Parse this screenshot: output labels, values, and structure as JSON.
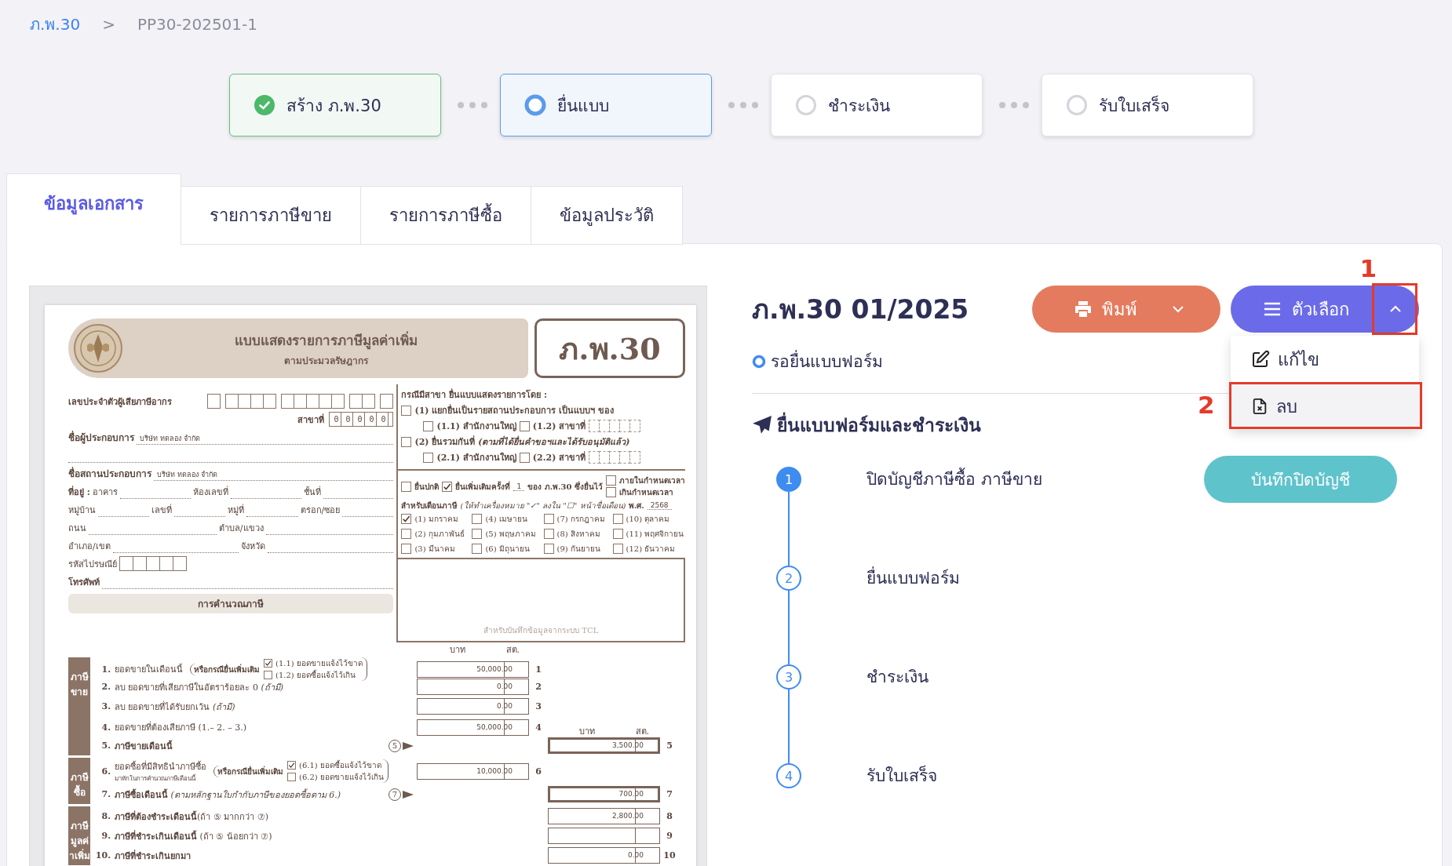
{
  "breadcrumb": {
    "items": [
      {
        "label": "ภ.พ.30",
        "kind": "link"
      },
      {
        "label": "PP30-202501-1",
        "kind": "current"
      }
    ],
    "separator": ">"
  },
  "progress_steps": [
    {
      "label": "สร้าง ภ.พ.30",
      "done": true,
      "selected": false
    },
    {
      "label": "ยื่นแบบ",
      "done": false,
      "selected": true
    },
    {
      "label": "ชำระเงิน",
      "done": false,
      "selected": false
    },
    {
      "label": "รับใบเสร็จ",
      "done": false,
      "selected": false
    }
  ],
  "tabs": [
    {
      "label": "ข้อมูลเอกสาร",
      "selected": true
    },
    {
      "label": "รายการภาษีขาย",
      "selected": false
    },
    {
      "label": "รายการภาษีซื้อ",
      "selected": false
    },
    {
      "label": "ข้อมูลประวัติ",
      "selected": false
    }
  ],
  "form": {
    "title": "แบบแสดงรายการภาษีมูลค่าเพิ่ม",
    "subtitle": "ตามประมวลรัษฎากร",
    "code": "ภ.พ.30",
    "taxpayer_id_label": "เลขประจำตัวผู้เสียภาษีอากร",
    "branch_label": "สาขาที่",
    "branch_number": "00000",
    "operator": {
      "label": "ชื่อผู้ประกอบการ",
      "value": "บริษัท ทดลอง จำกัด"
    },
    "establishment": {
      "label": "ชื่อสถานประกอบการ",
      "value": "บริษัท ทดลอง จำกัด"
    },
    "address_lines": [
      [
        "**ที่อยู่ :** อาคาร",
        "ห้องเลขที่",
        "ชั้นที่"
      ],
      [
        "หมู่บ้าน",
        "เลขที่",
        "หมู่ที่",
        "ตรอก/ซอย"
      ],
      [
        "ถนน",
        "ตำบล/แขวง"
      ],
      [
        "อำเภอ/เขต",
        "จังหวัด"
      ]
    ],
    "postcode_label": "รหัสไปรษณีย์",
    "phone_label": "โทรศัพท์",
    "calc_title": "การคำนวณภาษี",
    "branch_filing": {
      "title": "กรณีมีสาขา ยื่นแบบแสดงรายการโดย :",
      "options": [
        {
          "label": "(1) แยกยื่นเป็นรายสถานประกอบการ  เป็นแบบฯ ของ",
          "checked": false,
          "sub": [
            {
              "label": "(1.1) สำนักงานใหญ่",
              "checked": false,
              "kind": "plain"
            },
            {
              "label": "(1.2) สาขาที่",
              "checked": false,
              "kind": "branch"
            }
          ]
        },
        {
          "label": "(2) ยื่นรวมกันที่ *(ตามที่ได้ยื่นคำขอฯและได้รับอนุมัติแล้ว)*",
          "checked": false,
          "sub": [
            {
              "label": "(2.1) สำนักงานใหญ่",
              "checked": false,
              "kind": "plain"
            },
            {
              "label": "(2.2) สาขาที่",
              "checked": false,
              "kind": "branch"
            }
          ]
        }
      ]
    },
    "filing": {
      "normal": {
        "label": "ยื่นปกติ",
        "checked": false
      },
      "additional": {
        "label": "ยื่นเพิ่มเติมครั้งที่",
        "checked": true,
        "count": "1",
        "suffix": "ของ ภ.พ.30 ซึ่งยื่นไว้"
      },
      "timing": [
        {
          "label": "ภายในกำหนดเวลา",
          "checked": false
        },
        {
          "label": "เกินกำหนดเวลา",
          "checked": false
        }
      ]
    },
    "tax_month": {
      "label": "**สำหรับเดือนภาษี** *(ให้ทำเครื่องหมาย \"✓\" ลงใน \"☐\" หน้าชื่อเดือน)* **พ.ศ.**",
      "year": "2568",
      "months": [
        {
          "label": "(1) มกราคม",
          "checked": true
        },
        {
          "label": "(2) กุมภาพันธ์",
          "checked": false
        },
        {
          "label": "(3) มีนาคม",
          "checked": false
        },
        {
          "label": "(4) เมษายน",
          "checked": false
        },
        {
          "label": "(5) พฤษภาคม",
          "checked": false
        },
        {
          "label": "(6) มิถุนายน",
          "checked": false
        },
        {
          "label": "(7) กรกฎาคม",
          "checked": false
        },
        {
          "label": "(8) สิงหาคม",
          "checked": false
        },
        {
          "label": "(9) กันยายน",
          "checked": false
        },
        {
          "label": "(10) ตุลาคม",
          "checked": false
        },
        {
          "label": "(11) พฤศจิกายน",
          "checked": false
        },
        {
          "label": "(12) ธันวาคม",
          "checked": false
        }
      ]
    },
    "system_note": "สำหรับบันทึกข้อมูลจากระบบ TCL",
    "left_header": [
      "บาท",
      "สต."
    ],
    "right_header": [
      "บาท",
      "สต."
    ],
    "calc_groups": [
      {
        "label": "ภาษีขาย",
        "rows": [
          {
            "number": "1.",
            "label": "ยอดขายในเดือนนี้",
            "condition": "หรือกรณียื่นเพิ่มเติม",
            "options": [
              {
                "label": "(1.1) ยอดขายแจ้งไว้ขาด",
                "checked": true
              },
              {
                "label": "(1.2) ยอดซื้อแจ้งไว้เกิน",
                "checked": false
              }
            ],
            "kind": "left",
            "amount": "50,000.00",
            "line": "1"
          },
          {
            "number": "2.",
            "label": "ลบ ยอดขายที่เสียภาษีในอัตราร้อยละ 0 *(ถ้ามี)*",
            "kind": "left",
            "amount": "0.00",
            "line": "2"
          },
          {
            "number": "3.",
            "label": "ลบ ยอดขายที่ได้รับยกเว้น *(ถ้ามี)*",
            "kind": "left",
            "amount": "0.00",
            "line": "3"
          },
          {
            "number": "4.",
            "label": "ยอดขายที่ต้องเสียภาษี (1.– 2. – 3.)",
            "kind": "left",
            "amount": "50,000.00",
            "line": "4"
          },
          {
            "number": "5.",
            "label": "**ภาษีขายเดือนนี้**",
            "kind": "right",
            "marker": "5",
            "amount": "3,500.00",
            "line": "5"
          }
        ]
      },
      {
        "label": "ภาษีซื้อ",
        "rows": [
          {
            "number": "6.",
            "label": "ยอดซื้อที่มีสิทธินำภาษีซื้อ",
            "note": "มาหักในการคำนวณภาษีเดือนนี้",
            "condition": "หรือกรณียื่นเพิ่มเติม",
            "options": [
              {
                "label": "(6.1) ยอดซื้อแจ้งไว้ขาด",
                "checked": true
              },
              {
                "label": "(6.2) ยอดขายแจ้งไว้เกิน",
                "checked": false
              }
            ],
            "kind": "left",
            "amount": "10,000.00",
            "line": "6"
          },
          {
            "number": "7.",
            "label": "**ภาษีซื้อเดือนนี้** *(ตามหลักฐานใบกำกับภาษีของยอดซื้อตาม 6.)*",
            "kind": "right",
            "marker": "7",
            "amount": "700.00",
            "line": "7"
          }
        ]
      },
      {
        "label": "ภาษีมูลค่าเพิ่ม",
        "rows": [
          {
            "number": "8.",
            "label": "**ภาษีที่ต้องชำระเดือนนี้**(ถ้า ⑤ มากกว่า ⑦)",
            "kind": "right",
            "amount": "2,800.00",
            "line": "8"
          },
          {
            "number": "9.",
            "label": "**ภาษีที่ชำระเกินเดือนนี้** (ถ้า ⑤ น้อยกว่า ⑦)",
            "kind": "right",
            "line": "9"
          },
          {
            "number": "10.",
            "label": "**ภาษีที่ชำระเกินยกมา**",
            "kind": "right",
            "amount": "0.00",
            "line": "10"
          }
        ]
      }
    ]
  },
  "document": {
    "title": "ภ.พ.30 01/2025",
    "status": "รอยื่นแบบฟอร์ม",
    "print_button": "พิมพ์",
    "options_button": "ตัวเลือก",
    "options_menu": {
      "expanded": true,
      "toggle_annotation": "1",
      "items": [
        {
          "label": "แก้ไข",
          "kind": "edit",
          "selected": false
        },
        {
          "label": "ลบ",
          "kind": "delete",
          "selected": true,
          "annotation": "2"
        }
      ]
    }
  },
  "submission": {
    "title": "ยื่นแบบฟอร์มและชำระเงิน",
    "steps": [
      {
        "number": "1",
        "label": "ปิดบัญชีภาษีซื้อ ภาษีขาย",
        "active": true,
        "action": "บันทึกปิดบัญชี"
      },
      {
        "number": "2",
        "label": "ยื่นแบบฟอร์ม",
        "active": false
      },
      {
        "number": "3",
        "label": "ชำระเงิน",
        "active": false
      },
      {
        "number": "4",
        "label": "รับใบเสร็จ",
        "active": false
      }
    ]
  }
}
